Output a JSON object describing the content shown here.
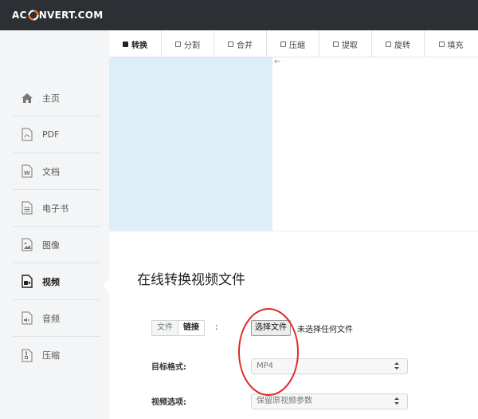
{
  "header": {
    "logo_left": "AC",
    "logo_right": "NVERT.COM",
    "logo_icon": "swirl-logo-icon"
  },
  "sidebar": {
    "items": [
      {
        "label": "主页",
        "icon": "home-icon"
      },
      {
        "label": "PDF",
        "icon": "pdf-file-icon"
      },
      {
        "label": "文档",
        "icon": "word-document-icon"
      },
      {
        "label": "电子书",
        "icon": "ebook-icon"
      },
      {
        "label": "图像",
        "icon": "image-file-icon"
      },
      {
        "label": "视频",
        "icon": "video-file-icon"
      },
      {
        "label": "音频",
        "icon": "audio-file-icon"
      },
      {
        "label": "压缩",
        "icon": "archive-file-icon"
      }
    ],
    "active_index": 5
  },
  "tabs": [
    {
      "label": "转换",
      "active": true
    },
    {
      "label": "分割",
      "active": false
    },
    {
      "label": "合并",
      "active": false
    },
    {
      "label": "压缩",
      "active": false
    },
    {
      "label": "提取",
      "active": false
    },
    {
      "label": "旋转",
      "active": false
    },
    {
      "label": "填充",
      "active": false
    }
  ],
  "back_arrow": "←",
  "main": {
    "title": "在线转换视频文件",
    "source_toggle": {
      "file": "文件",
      "link": "链接",
      "colon": ":"
    },
    "file_button": "选择文件",
    "no_file_text": "未选择任何文件",
    "target_format_label": "目标格式:",
    "target_format_value": "MP4",
    "video_options_label": "视频选项:",
    "video_options_value": "保留原视频参数"
  },
  "colors": {
    "header_bg": "#2c3034",
    "sidebar_bg": "#f4f5f6",
    "ad_panel_bg": "#dceef8",
    "annotation_red": "#e0252a"
  }
}
